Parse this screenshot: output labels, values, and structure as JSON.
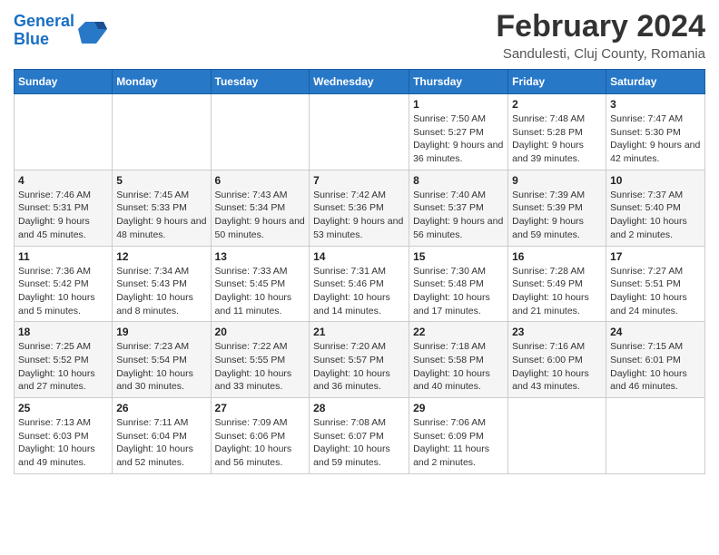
{
  "header": {
    "logo_line1": "General",
    "logo_line2": "Blue",
    "title": "February 2024",
    "subtitle": "Sandulesti, Cluj County, Romania"
  },
  "weekdays": [
    "Sunday",
    "Monday",
    "Tuesday",
    "Wednesday",
    "Thursday",
    "Friday",
    "Saturday"
  ],
  "weeks": [
    [
      {
        "day": "",
        "info": ""
      },
      {
        "day": "",
        "info": ""
      },
      {
        "day": "",
        "info": ""
      },
      {
        "day": "",
        "info": ""
      },
      {
        "day": "1",
        "info": "Sunrise: 7:50 AM\nSunset: 5:27 PM\nDaylight: 9 hours and 36 minutes."
      },
      {
        "day": "2",
        "info": "Sunrise: 7:48 AM\nSunset: 5:28 PM\nDaylight: 9 hours and 39 minutes."
      },
      {
        "day": "3",
        "info": "Sunrise: 7:47 AM\nSunset: 5:30 PM\nDaylight: 9 hours and 42 minutes."
      }
    ],
    [
      {
        "day": "4",
        "info": "Sunrise: 7:46 AM\nSunset: 5:31 PM\nDaylight: 9 hours and 45 minutes."
      },
      {
        "day": "5",
        "info": "Sunrise: 7:45 AM\nSunset: 5:33 PM\nDaylight: 9 hours and 48 minutes."
      },
      {
        "day": "6",
        "info": "Sunrise: 7:43 AM\nSunset: 5:34 PM\nDaylight: 9 hours and 50 minutes."
      },
      {
        "day": "7",
        "info": "Sunrise: 7:42 AM\nSunset: 5:36 PM\nDaylight: 9 hours and 53 minutes."
      },
      {
        "day": "8",
        "info": "Sunrise: 7:40 AM\nSunset: 5:37 PM\nDaylight: 9 hours and 56 minutes."
      },
      {
        "day": "9",
        "info": "Sunrise: 7:39 AM\nSunset: 5:39 PM\nDaylight: 9 hours and 59 minutes."
      },
      {
        "day": "10",
        "info": "Sunrise: 7:37 AM\nSunset: 5:40 PM\nDaylight: 10 hours and 2 minutes."
      }
    ],
    [
      {
        "day": "11",
        "info": "Sunrise: 7:36 AM\nSunset: 5:42 PM\nDaylight: 10 hours and 5 minutes."
      },
      {
        "day": "12",
        "info": "Sunrise: 7:34 AM\nSunset: 5:43 PM\nDaylight: 10 hours and 8 minutes."
      },
      {
        "day": "13",
        "info": "Sunrise: 7:33 AM\nSunset: 5:45 PM\nDaylight: 10 hours and 11 minutes."
      },
      {
        "day": "14",
        "info": "Sunrise: 7:31 AM\nSunset: 5:46 PM\nDaylight: 10 hours and 14 minutes."
      },
      {
        "day": "15",
        "info": "Sunrise: 7:30 AM\nSunset: 5:48 PM\nDaylight: 10 hours and 17 minutes."
      },
      {
        "day": "16",
        "info": "Sunrise: 7:28 AM\nSunset: 5:49 PM\nDaylight: 10 hours and 21 minutes."
      },
      {
        "day": "17",
        "info": "Sunrise: 7:27 AM\nSunset: 5:51 PM\nDaylight: 10 hours and 24 minutes."
      }
    ],
    [
      {
        "day": "18",
        "info": "Sunrise: 7:25 AM\nSunset: 5:52 PM\nDaylight: 10 hours and 27 minutes."
      },
      {
        "day": "19",
        "info": "Sunrise: 7:23 AM\nSunset: 5:54 PM\nDaylight: 10 hours and 30 minutes."
      },
      {
        "day": "20",
        "info": "Sunrise: 7:22 AM\nSunset: 5:55 PM\nDaylight: 10 hours and 33 minutes."
      },
      {
        "day": "21",
        "info": "Sunrise: 7:20 AM\nSunset: 5:57 PM\nDaylight: 10 hours and 36 minutes."
      },
      {
        "day": "22",
        "info": "Sunrise: 7:18 AM\nSunset: 5:58 PM\nDaylight: 10 hours and 40 minutes."
      },
      {
        "day": "23",
        "info": "Sunrise: 7:16 AM\nSunset: 6:00 PM\nDaylight: 10 hours and 43 minutes."
      },
      {
        "day": "24",
        "info": "Sunrise: 7:15 AM\nSunset: 6:01 PM\nDaylight: 10 hours and 46 minutes."
      }
    ],
    [
      {
        "day": "25",
        "info": "Sunrise: 7:13 AM\nSunset: 6:03 PM\nDaylight: 10 hours and 49 minutes."
      },
      {
        "day": "26",
        "info": "Sunrise: 7:11 AM\nSunset: 6:04 PM\nDaylight: 10 hours and 52 minutes."
      },
      {
        "day": "27",
        "info": "Sunrise: 7:09 AM\nSunset: 6:06 PM\nDaylight: 10 hours and 56 minutes."
      },
      {
        "day": "28",
        "info": "Sunrise: 7:08 AM\nSunset: 6:07 PM\nDaylight: 10 hours and 59 minutes."
      },
      {
        "day": "29",
        "info": "Sunrise: 7:06 AM\nSunset: 6:09 PM\nDaylight: 11 hours and 2 minutes."
      },
      {
        "day": "",
        "info": ""
      },
      {
        "day": "",
        "info": ""
      }
    ]
  ]
}
